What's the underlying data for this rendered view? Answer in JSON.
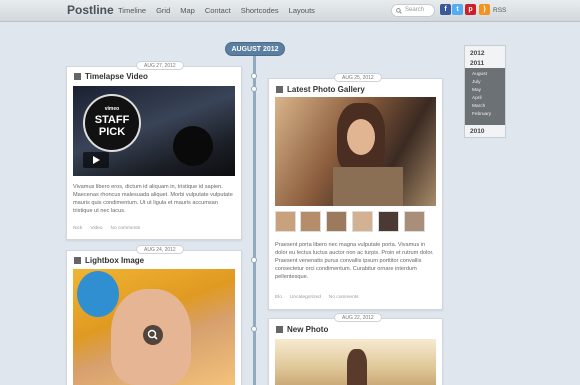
{
  "header": {
    "logo": "Postline",
    "nav": [
      "Timeline",
      "Grid",
      "Map",
      "Contact",
      "Shortcodes",
      "Layouts"
    ],
    "search_placeholder": "Search",
    "rss": "RSS"
  },
  "month_label": "AUGUST 2012",
  "archive": {
    "years": [
      "2012",
      "2011",
      "2010"
    ],
    "months": [
      "August",
      "July",
      "May",
      "April",
      "March",
      "February"
    ]
  },
  "posts": [
    {
      "date": "AUG 27, 2012",
      "title": "Timelapse Video",
      "badge1": "vimeo",
      "badge2": "STAFF",
      "badge3": "PICK",
      "text": "Vivamus libero eros, dictum id aliquam in, tristique id sapien. Maecenas rhoncus malesuada aliquet. Morbi vulputate vulputate mauris quis condimentum. Ut ut ligula et mauris accumsan tristique ut nec lacus.",
      "author": "Nick",
      "category": "Video",
      "comments": "No comments"
    },
    {
      "date": "AUG 25, 2012",
      "title": "Latest Photo Gallery",
      "text": "Praesent porta libero nec magna vulputate porta. Vivamus in dolor eu lectus luctus auctor non ac turpis. Proin et rutrum dolor. Praesent venenatis purus convallis ipsum porttitor convallis consectetur orci condimentum. Curabitur ornare interdum pellentesque.",
      "author": "Elo",
      "category": "Uncategorized",
      "comments": "No comments"
    },
    {
      "date": "AUG 24, 2012",
      "title": "Lightbox Image"
    },
    {
      "date": "AUG 22, 2012",
      "title": "New Photo"
    }
  ],
  "colors": {
    "accent": "#5b7fa0",
    "background": "#dfe6ee"
  }
}
